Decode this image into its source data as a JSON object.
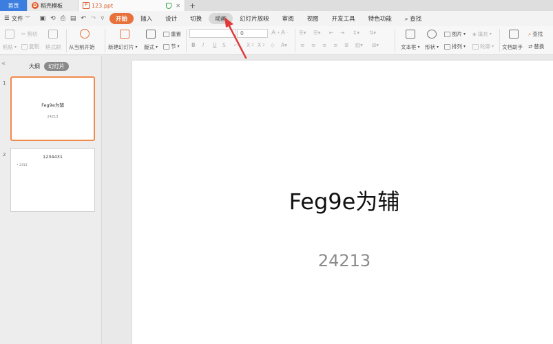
{
  "tabs": {
    "home": "首页",
    "template": "稻壳模板",
    "file": "123.ppt",
    "add": "+"
  },
  "menubar": {
    "file_label": "文件",
    "items": [
      "开始",
      "插入",
      "设计",
      "切换",
      "动画",
      "幻灯片放映",
      "审阅",
      "视图",
      "开发工具",
      "特色功能"
    ],
    "search_label": "查找"
  },
  "ribbon": {
    "paste": "粘贴",
    "cut": "剪切",
    "copy": "复制",
    "format_painter": "格式刷",
    "start_from_current": "从当前开始",
    "new_slide": "新建幻灯片",
    "layout": "版式",
    "reset": "重置",
    "section": "节",
    "font_size_value": "0",
    "textbox": "文本框",
    "shape": "形状",
    "picture": "图片",
    "fill": "填充",
    "arrange": "排列",
    "outline": "轮廓",
    "doc_assistant": "文档助手",
    "find": "查找",
    "replace": "替换"
  },
  "left_panel": {
    "outline_tab": "大纲",
    "slides_tab": "幻灯片",
    "slides": [
      {
        "number": "1",
        "title": "Feg9e为辅",
        "subtitle": "24213"
      },
      {
        "number": "2",
        "title": "1234431",
        "bullet": "• 2313"
      }
    ]
  },
  "slide": {
    "title": "Feg9e为辅",
    "subtitle": "24213"
  },
  "colors": {
    "accent_active": "#e8703a",
    "home_tab": "#3c7ee0",
    "annotation_arrow": "#e03a3a"
  }
}
